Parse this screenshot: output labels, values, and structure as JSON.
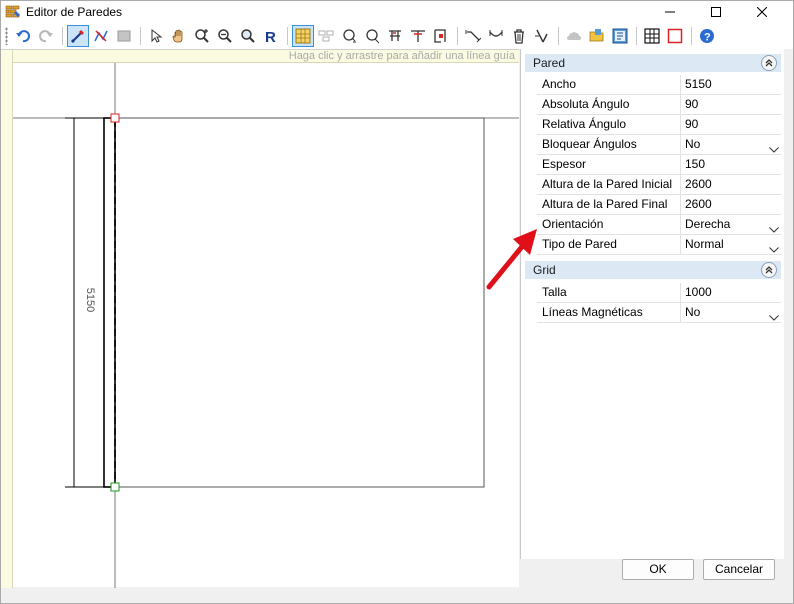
{
  "window": {
    "title": "Editor de Paredes",
    "controls": {
      "minimize": "minimize-icon",
      "maximize": "maximize-icon",
      "close": "close-icon"
    }
  },
  "toolbar": {
    "buttons": [
      {
        "name": "undo-icon",
        "active": false
      },
      {
        "name": "redo-icon",
        "active": false
      },
      {
        "name": "draw-wall-icon",
        "active": true
      },
      {
        "name": "draw-polyline-icon",
        "active": false
      },
      {
        "name": "fill-icon",
        "active": false
      },
      {
        "name": "pointer-icon",
        "active": false
      },
      {
        "name": "pan-hand-icon",
        "active": false
      },
      {
        "name": "zoom-in-icon",
        "active": false
      },
      {
        "name": "zoom-out-icon",
        "active": false
      },
      {
        "name": "zoom-icon",
        "active": false
      },
      {
        "name": "redraw-icon",
        "active": false
      },
      {
        "name": "snap-grid-icon",
        "active": true
      }
    ]
  },
  "canvas": {
    "hint": "Haga clic y arrastre para añadir una línea guía",
    "dimension_label": "5150"
  },
  "panel": {
    "pared": {
      "title": "Pared",
      "rows": [
        {
          "label": "Ancho",
          "value": "5150",
          "dropdown": false
        },
        {
          "label": "Absoluta Ángulo",
          "value": "90",
          "dropdown": false
        },
        {
          "label": "Relativa Ángulo",
          "value": "90",
          "dropdown": false
        },
        {
          "label": "Bloquear Ángulos",
          "value": "No",
          "dropdown": true
        },
        {
          "label": "Espesor",
          "value": "150",
          "dropdown": false
        },
        {
          "label": "Altura de la Pared Inicial",
          "value": "2600",
          "dropdown": false
        },
        {
          "label": "Altura de la Pared Final",
          "value": "2600",
          "dropdown": false
        },
        {
          "label": "Orientación",
          "value": "Derecha",
          "dropdown": true
        },
        {
          "label": "Tipo de Pared",
          "value": "Normal",
          "dropdown": true
        }
      ]
    },
    "grid": {
      "title": "Grid",
      "rows": [
        {
          "label": "Talla",
          "value": "1000",
          "dropdown": false
        },
        {
          "label": "Líneas Magnéticas",
          "value": "No",
          "dropdown": true
        }
      ]
    }
  },
  "footer": {
    "ok": "OK",
    "cancel": "Cancelar"
  },
  "colors": {
    "annotation_arrow": "#e0101a",
    "header_bg": "#dde8f5",
    "ruler_bg": "#fbfbe2"
  }
}
